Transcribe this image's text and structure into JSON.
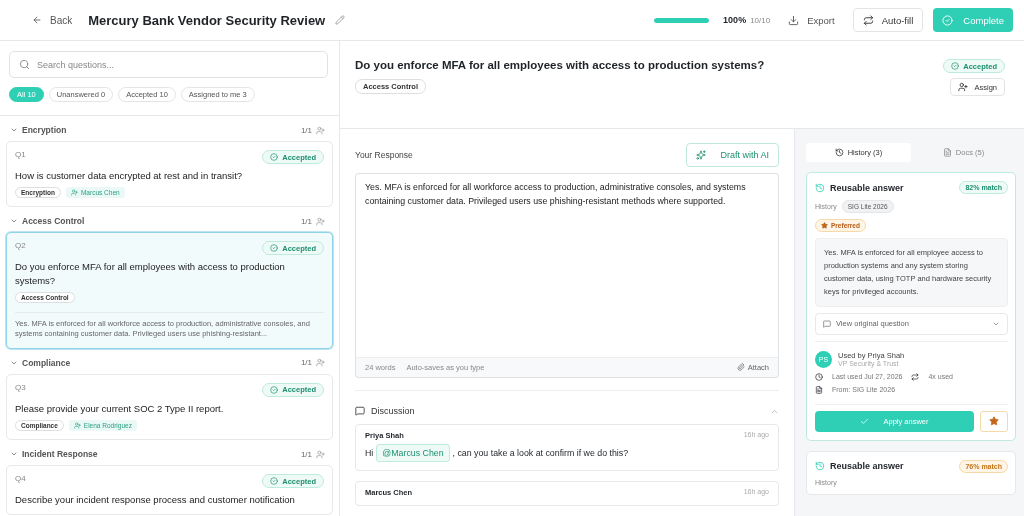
{
  "header": {
    "back": "Back",
    "title": "Mercury Bank Vendor Security Review",
    "progress": {
      "level": 1,
      "percent": "100%",
      "count": "10/10"
    },
    "export": "Export",
    "autofill": "Auto-fill",
    "complete": "Complete"
  },
  "sidebar": {
    "search": {
      "placeholder": "Search questions..."
    },
    "filters": [
      {
        "label": "All 10",
        "selected": true
      },
      {
        "label": "Unanswered 0",
        "selected": false
      },
      {
        "label": "Accepted 10",
        "selected": false
      },
      {
        "label": "Assigned to me 3",
        "selected": false
      }
    ],
    "sections": [
      {
        "name": "Encryption",
        "count": "1/1",
        "expanded": true,
        "questions": [
          {
            "id": "Q1",
            "status": "Accepted",
            "text": "How is customer data encrypted at rest and in transit?",
            "tag": "Encryption",
            "assignee": "Marcus Chen",
            "selected": false
          }
        ]
      },
      {
        "name": "Access Control",
        "count": "1/1",
        "expanded": true,
        "questions": [
          {
            "id": "Q2",
            "status": "Accepted",
            "text": "Do you enforce MFA for all employees with access to production systems?",
            "tag": "Access Control",
            "answer": "Yes. MFA is enforced for all workforce access to production, administrative consoles, and systems containing customer data. Privileged users use phishing-resistant...",
            "selected": true
          }
        ]
      },
      {
        "name": "Compliance",
        "count": "1/1",
        "expanded": true,
        "questions": [
          {
            "id": "Q3",
            "status": "Accepted",
            "text": "Please provide your current SOC 2 Type II report.",
            "tag": "Compliance",
            "assignee": "Elena Rodriguez",
            "selected": false
          }
        ]
      },
      {
        "name": "Incident Response",
        "count": "1/1",
        "expanded": true,
        "questions": [
          {
            "id": "Q4",
            "status": "Accepted",
            "text": "Describe your incident response process and customer notification",
            "selected": false
          }
        ]
      }
    ]
  },
  "question": {
    "title": "Do you enforce MFA for all employees with access to production systems?",
    "tag": "Access Control",
    "status": "Accepted",
    "assign": "Assign"
  },
  "response": {
    "label": "Your Response",
    "draft": "Draft with AI",
    "value": "Yes. MFA is enforced for all workforce access to production, administrative consoles, and systems containing customer data. Privileged users use phishing-resistant methods where supported.",
    "word_count": "24 words",
    "autosave": "Auto-saves as you type",
    "attach": "Attach"
  },
  "discussion": {
    "title": "Discussion",
    "expanded": true,
    "comments": [
      {
        "author": "Priya Shah",
        "time": "16h ago",
        "parts": [
          {
            "kind": "text",
            "text": "Hi"
          },
          {
            "kind": "mention",
            "text": "@Marcus Chen"
          },
          {
            "kind": "text",
            "text": ", can you take a look at confirm if we do this?"
          }
        ]
      },
      {
        "author": "Marcus Chen",
        "time": "16h ago"
      }
    ]
  },
  "library": {
    "tabs": [
      {
        "label": "History (3)",
        "kind": "history",
        "selected": true
      },
      {
        "label": "Docs (5)",
        "kind": "docs",
        "selected": false
      }
    ],
    "answers": [
      {
        "title": "Reusable answer",
        "match": "82% match",
        "kind": "strong",
        "source_label": "History",
        "source": "SIG Lite 2026",
        "preferred": "Preferred",
        "text": "Yes. MFA is enforced for all employee access to production systems and any system storing customer data, using TOTP and hardware security keys for privileged accounts.",
        "view": "View original question",
        "initials": "PS",
        "used_by": "Used by Priya Shah",
        "role": "VP Security & Trust",
        "last_used": "Last used Jul 27, 2026",
        "uses": "4x used",
        "from": "From: SIG Lite 2026",
        "apply": "Apply answer",
        "starred": true
      },
      {
        "title": "Reusable answer",
        "match": "76% match",
        "kind": "partial",
        "source_label": "History"
      }
    ]
  }
}
